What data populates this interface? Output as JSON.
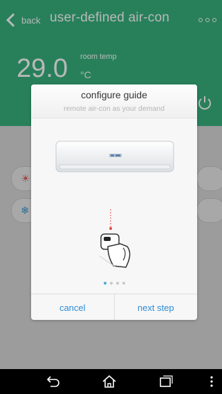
{
  "header": {
    "back_label": "back",
    "title": "user-defined air-con"
  },
  "status": {
    "temperature": "29.0",
    "unit": "°C",
    "label": "room temp"
  },
  "background_mode": {
    "label": "cooling"
  },
  "dialog": {
    "title": "configure guide",
    "subtitle": "remote air-con as your demand",
    "page_count": 4,
    "active_page": 1,
    "cancel_label": "cancel",
    "next_label": "next step"
  },
  "colors": {
    "header": "#38b27e",
    "accent": "#2d8bd6",
    "dialog": "#f7f7f7"
  },
  "icons": {
    "back": "chevron-left-icon",
    "more": "more-dots-icon",
    "power": "power-icon",
    "heat": "sun-icon",
    "cool": "snowflake-icon"
  }
}
